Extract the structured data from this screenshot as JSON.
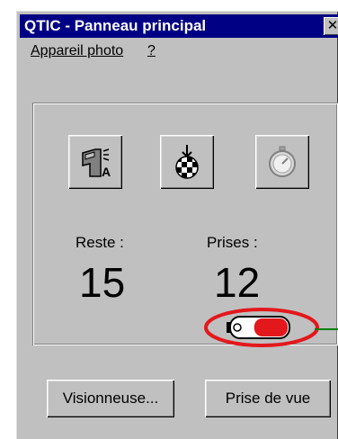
{
  "window": {
    "title": "QTIC - Panneau principal",
    "close_glyph": "✕"
  },
  "menu": {
    "items": [
      {
        "label": "Appareil photo"
      },
      {
        "label": "?"
      }
    ]
  },
  "toolbar": {
    "icons": [
      "camera-settings-icon",
      "checkered-download-icon",
      "stopwatch-icon"
    ]
  },
  "status": {
    "reste_label": "Reste :",
    "reste_value": "15",
    "prises_label": "Prises :",
    "prises_value": "12",
    "battery_level": 0.6
  },
  "buttons": {
    "visionneuse": "Visionneuse...",
    "prise_de_vue": "Prise de vue"
  },
  "colors": {
    "titlebar": "#000084",
    "face": "#c0c0c0",
    "highlight": "#e3181d",
    "callout": "#008000"
  }
}
